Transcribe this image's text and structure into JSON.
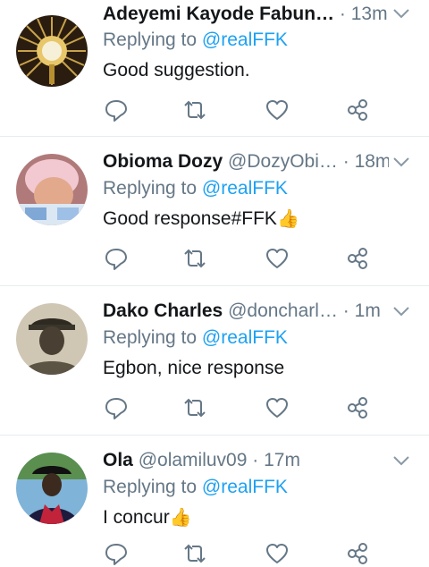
{
  "tweets": [
    {
      "name": "Adeyemi Kayode Fabun…",
      "handle": "",
      "sep": "·",
      "time": "13m",
      "reply_prefix": "Replying to ",
      "reply_mention": "@realFFK",
      "text": "Good suggestion.",
      "emoji": ""
    },
    {
      "name": "Obioma Dozy",
      "handle": "@DozyObi…",
      "sep": "·",
      "time": "18m",
      "reply_prefix": "Replying to ",
      "reply_mention": "@realFFK",
      "text": "Good response#FFK",
      "emoji": "👍"
    },
    {
      "name": "Dako  Charles",
      "handle": "@doncharl…",
      "sep": "·",
      "time": "1m",
      "reply_prefix": "Replying to ",
      "reply_mention": "@realFFK",
      "text": "Egbon,  nice response",
      "emoji": ""
    },
    {
      "name": "Ola",
      "handle": "@olamiluv09",
      "sep": "·",
      "time": "17m",
      "reply_prefix": "Replying to ",
      "reply_mention": "@realFFK",
      "text": "I concur",
      "emoji": "👍"
    }
  ],
  "colors": {
    "accent": "#1da1f2",
    "secondary_text": "#657786",
    "primary_text": "#14171a",
    "divider": "#e6ecf0"
  },
  "icons": [
    "reply-icon",
    "retweet-icon",
    "like-icon",
    "share-icon",
    "chevron-down-icon"
  ]
}
